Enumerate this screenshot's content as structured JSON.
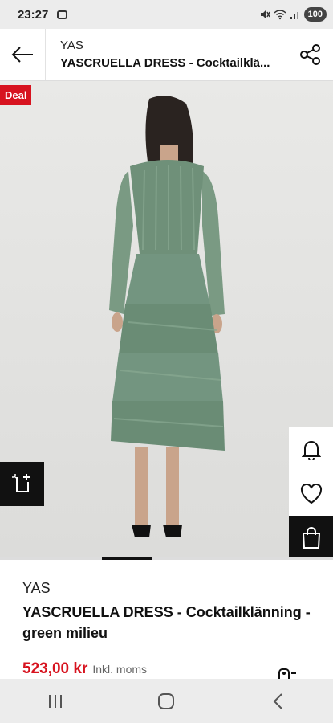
{
  "status_bar": {
    "time": "23:27",
    "battery": "100",
    "icons": [
      "screen-record-icon",
      "mute-icon",
      "wifi-icon",
      "signal-icon"
    ]
  },
  "header": {
    "brand": "YAS",
    "title": "YASCRUELLA DRESS - Cocktailklä...",
    "back_icon": "arrow-left-icon",
    "share_icon": "share-icon"
  },
  "image": {
    "badge": "Deal",
    "subject": "dress-photo",
    "dress_color": "#6f9079",
    "compare_icon": "compare-icon",
    "side_actions": [
      "bell-icon",
      "heart-icon",
      "shopping-bag-icon"
    ]
  },
  "product": {
    "brand": "YAS",
    "name": "YASCRUELLA DRESS - Cocktailklänning - green milieu",
    "price": "523,00 kr",
    "vat_note": "Inkl. moms"
  },
  "colors": {
    "accent": "#d7131f",
    "dark": "#111111"
  },
  "nav": [
    "recents-icon",
    "home-icon",
    "back-icon"
  ]
}
